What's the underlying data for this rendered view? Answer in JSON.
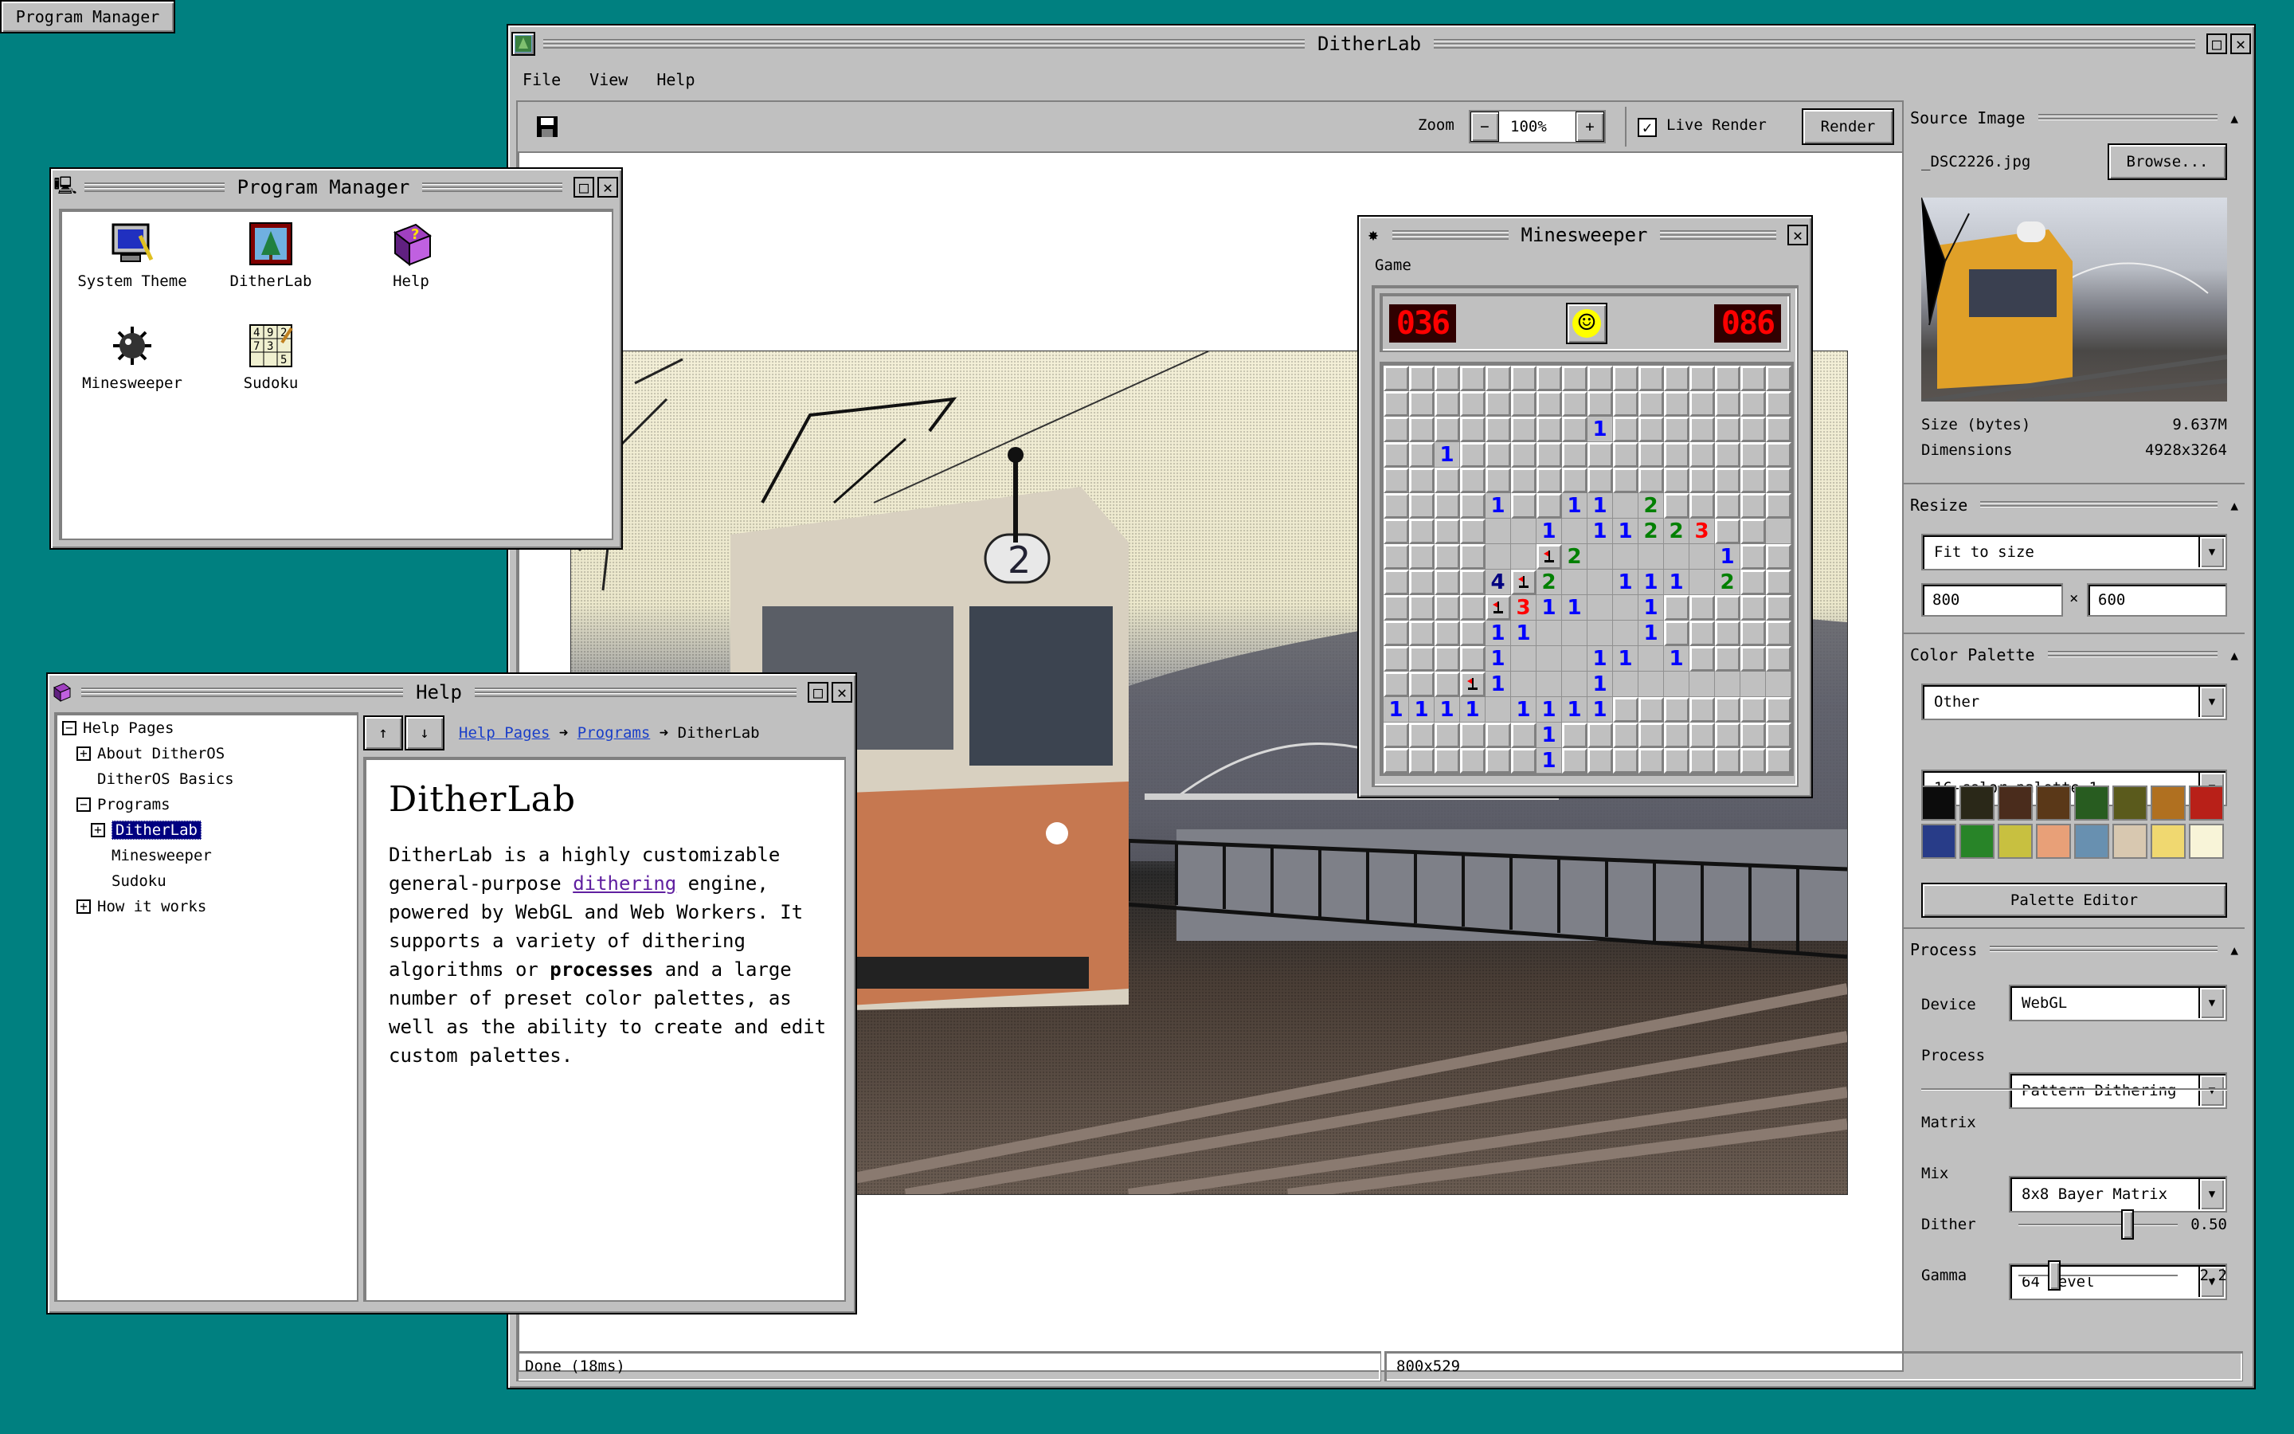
{
  "taskbar": {
    "program_manager_button": "Program Manager"
  },
  "ditherlab": {
    "title": "DitherLab",
    "menu": [
      "File",
      "View",
      "Help"
    ],
    "toolbar": {
      "zoom_label": "Zoom",
      "zoom_minus": "−",
      "zoom_value": "100%",
      "zoom_plus": "+",
      "live_render_label": "Live Render",
      "live_render_checked": true,
      "render_button": "Render"
    },
    "status": {
      "left": "Done (18ms)",
      "right": "800x529"
    },
    "panel": {
      "source": {
        "heading": "Source Image",
        "filename": "_DSC2226.jpg",
        "browse": "Browse...",
        "size_label": "Size (bytes)",
        "size_value": "9.637M",
        "dims_label": "Dimensions",
        "dims_value": "4928x3264"
      },
      "resize": {
        "heading": "Resize",
        "mode": "Fit to size",
        "width": "800",
        "times": "×",
        "height": "600"
      },
      "palette": {
        "heading": "Color Palette",
        "category": "Other",
        "palette": "16-color palette 1",
        "colors": [
          "#0c0c0c",
          "#2a2818",
          "#4a2c1c",
          "#5a3818",
          "#285c20",
          "#5a5a1c",
          "#b07020",
          "#b82018",
          "#283c88",
          "#288428",
          "#c8c040",
          "#e8a078",
          "#6890b0",
          "#d8c8b0",
          "#f0d870",
          "#f8f4d8"
        ],
        "editor_button": "Palette Editor"
      },
      "process": {
        "heading": "Process",
        "device_label": "Device",
        "device_value": "WebGL",
        "process_label": "Process",
        "process_value": "Pattern Dithering",
        "matrix_label": "Matrix",
        "matrix_value": "8x8 Bayer Matrix",
        "mix_label": "Mix",
        "mix_value": "64 level",
        "dither_label": "Dither",
        "dither_value": "0.50",
        "dither_fraction": 0.7,
        "gamma_label": "Gamma",
        "gamma_value": "2.2",
        "gamma_fraction": 0.2
      }
    }
  },
  "program_manager": {
    "title": "Program Manager",
    "icons": [
      {
        "label": "System Theme",
        "icon": "monitor-icon"
      },
      {
        "label": "DitherLab",
        "icon": "picture-icon"
      },
      {
        "label": "Help",
        "icon": "help-book-icon"
      },
      {
        "label": "Minesweeper",
        "icon": "mine-icon"
      },
      {
        "label": "Sudoku",
        "icon": "sudoku-icon"
      }
    ]
  },
  "help": {
    "title": "Help",
    "tree": [
      {
        "label": "Help Pages",
        "box": "−",
        "indent": 0
      },
      {
        "label": "About DitherOS",
        "box": "+",
        "indent": 1
      },
      {
        "label": "DitherOS Basics",
        "box": "",
        "indent": 1
      },
      {
        "label": "Programs",
        "box": "−",
        "indent": 1
      },
      {
        "label": "DitherLab",
        "box": "+",
        "indent": 2,
        "selected": true
      },
      {
        "label": "Minesweeper",
        "box": "",
        "indent": 2
      },
      {
        "label": "Sudoku",
        "box": "",
        "indent": 2
      },
      {
        "label": "How it works",
        "box": "+",
        "indent": 1
      }
    ],
    "nav_up": "↑",
    "nav_down": "↓",
    "breadcrumb": [
      "Help Pages",
      "Programs",
      "DitherLab"
    ],
    "arrow": "➜",
    "page_title": "DitherLab",
    "body_before_link": "DitherLab is a highly customizable general-purpose ",
    "body_link": "dithering",
    "body_middle": " engine, powered by WebGL and Web Workers. It supports a variety of dithering algorithms or ",
    "body_bold": "processes",
    "body_after": " and a large number of preset color palettes, as well as the ability to create and edit custom palettes."
  },
  "minesweeper": {
    "title": "Minesweeper",
    "menu": "Game",
    "mines_left": "036",
    "timer": "086",
    "face": "☺",
    "grid": [
      "################",
      "################",
      "########1#######",
      "##1#############",
      "################",
      "####1##11.2#####",
      "####..1.11223##.",
      "####..F2.....1##",
      "####4F2..111.2##",
      "####F311..1#####",
      "####11....1#####",
      "####1...11.1####",
      "###F1...1.......",
      "1111.1111#######",
      "######1#########",
      "######1#########"
    ]
  }
}
